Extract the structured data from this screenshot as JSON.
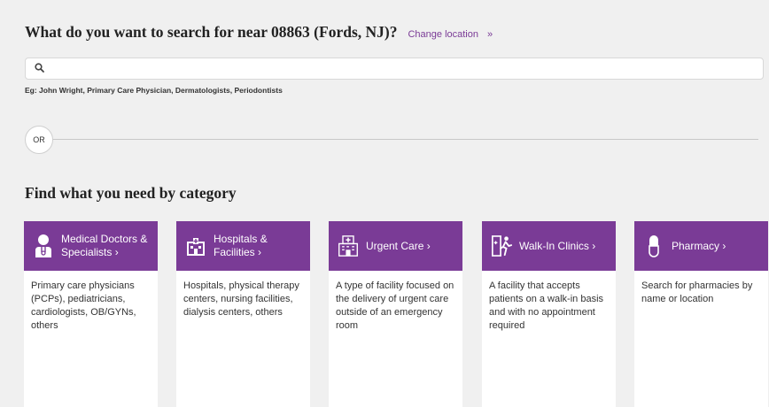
{
  "header": {
    "title": "What do you want to search for near 08863 (Fords, NJ)?",
    "change_location_label": "Change location",
    "change_location_chevron": "»"
  },
  "search": {
    "icon": "search-icon",
    "placeholder": "",
    "value": "",
    "example": "Eg: John Wright, Primary Care Physician, Dermatologists, Periodontists"
  },
  "divider": {
    "label": "OR"
  },
  "categories": {
    "heading": "Find what you need by category",
    "accent_color": "#7a3b96",
    "items": [
      {
        "icon": "doctor-icon",
        "title_line1": "Medical Doctors &",
        "title_line2": "Specialists ›",
        "description": "Primary care physicians (PCPs), pediatricians, cardiologists, OB/GYNs, others"
      },
      {
        "icon": "hospital-icon",
        "title_line1": "Hospitals &",
        "title_line2": "Facilities ›",
        "description": "Hospitals, physical therapy centers, nursing facilities, dialysis centers, others"
      },
      {
        "icon": "urgent-care-icon",
        "title_line1": "Urgent Care ›",
        "title_line2": "",
        "description": "A type of facility focused on the delivery of urgent care outside of an emergency room"
      },
      {
        "icon": "walk-in-icon",
        "title_line1": "Walk-In Clinics ›",
        "title_line2": "",
        "description": "A facility that accepts patients on a walk-in basis and with no appointment required"
      },
      {
        "icon": "pill-icon",
        "title_line1": "Pharmacy ›",
        "title_line2": "",
        "description": "Search for pharmacies by name or location"
      }
    ]
  }
}
